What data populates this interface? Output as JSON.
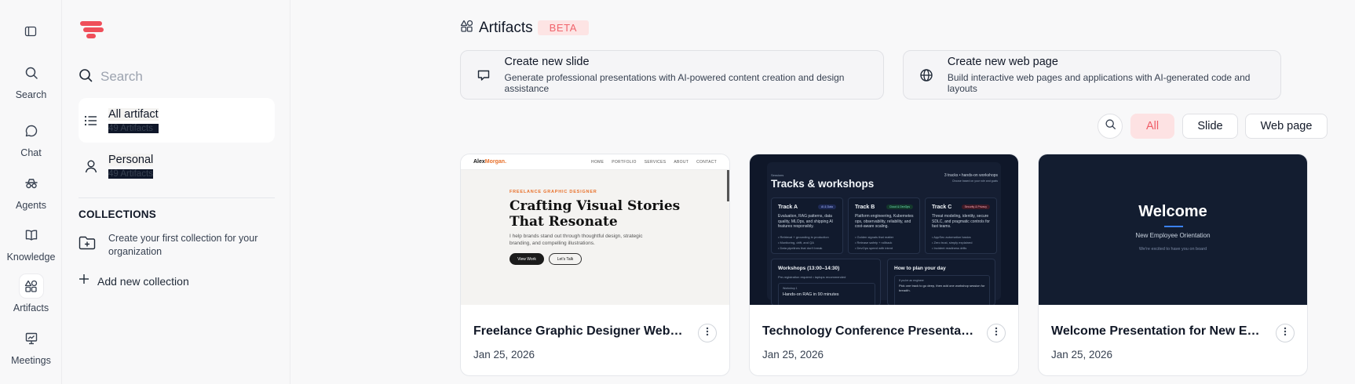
{
  "rail": {
    "items": [
      {
        "label": "Search",
        "icon": "search-icon"
      },
      {
        "label": "Chat",
        "icon": "chat-icon"
      },
      {
        "label": "Agents",
        "icon": "agents-icon"
      },
      {
        "label": "Knowledge",
        "icon": "book-icon"
      },
      {
        "label": "Artifacts",
        "icon": "artifacts-icon",
        "active": true
      },
      {
        "label": "Meetings",
        "icon": "presentation-icon"
      }
    ]
  },
  "panel": {
    "search_placeholder": "Search",
    "nav": [
      {
        "title": "All artifact",
        "count": "49 Artifacts",
        "icon": "list-icon",
        "active": true
      },
      {
        "title": "Personal",
        "count": "49 Artifacts",
        "icon": "user-icon"
      }
    ],
    "collections_heading": "COLLECTIONS",
    "collections_empty": "Create your first collection for your organization",
    "add_collection": "Add new collection"
  },
  "main": {
    "title": "Artifacts",
    "badge": "BETA",
    "create": [
      {
        "title": "Create new slide",
        "desc": "Generate professional presentations with AI-powered content creation and design assistance",
        "icon": "slide-icon"
      },
      {
        "title": "Create new web page",
        "desc": "Build interactive web pages and applications with AI-generated code and layouts",
        "icon": "globe-icon"
      }
    ],
    "filters": [
      "All",
      "Slide",
      "Web page"
    ],
    "active_filter": "All",
    "cards": [
      {
        "title": "Freelance Graphic Designer Website",
        "date": "Jan 25, 2026",
        "thumb": {
          "brand_a": "Alex",
          "brand_b": "Morgan.",
          "links": [
            "HOME",
            "PORTFOLIO",
            "SERVICES",
            "ABOUT",
            "CONTACT"
          ],
          "kicker": "FREELANCE GRAPHIC DESIGNER",
          "headline": "Crafting Visual Stories That Resonate",
          "para": "I help brands stand out through thoughtful design, strategic branding, and compelling illustrations.",
          "btn1": "View Work",
          "btn2": "Let's Talk"
        }
      },
      {
        "title": "Technology Conference Presentation",
        "date": "Jan 25, 2026",
        "thumb": {
          "kicker": "Sessions",
          "headline": "Tracks & workshops",
          "aside_1": "3 tracks • hands-on workshops",
          "aside_2": "Choose based on your role and goals",
          "tracks": [
            {
              "name": "Track A",
              "pill": "AI & Data",
              "desc": "Evaluation, RAG patterns, data quality, MLOps, and shipping AI features responsibly.",
              "bullets": [
                "• Retrieval + grounding in production",
                "• Monitoring, drift, and QA",
                "• Data pipelines that don't break"
              ]
            },
            {
              "name": "Track B",
              "pill": "Cloud & DevOps",
              "desc": "Platform engineering, Kubernetes ops, observability, reliability, and cost-aware scaling.",
              "bullets": [
                "• Golden signals that matter",
                "• Release safety + rollback",
                "• DevOps speed with intent"
              ]
            },
            {
              "name": "Track C",
              "pill": "Security & Privacy",
              "desc": "Threat modeling, identity, secure SDLC, and pragmatic controls for fast teams.",
              "bullets": [
                "• AppSec automation basics",
                "• Zero trust, simply explained",
                "• Incident readiness drills"
              ]
            }
          ],
          "workshops_title": "Workshops (13:00–14:30)",
          "workshops_sub": "Pre-registration required • laptops recommended",
          "workshop_kicker": "Workshop 1",
          "workshop_name": "Hands-on RAG in 90 minutes",
          "plan_title": "How to plan your day",
          "plan_kicker": "If you're an engineer",
          "plan_text": "Pick one track to go deep, then add one workshop session for breadth."
        }
      },
      {
        "title": "Welcome Presentation for New Employee Orientation",
        "date": "Jan 25, 2026",
        "thumb": {
          "headline": "Welcome",
          "sub": "New Employee Orientation",
          "sub2": "We're excited to have you on board"
        }
      }
    ]
  },
  "colors": {
    "accent": "#ef5d67",
    "accent_bg": "#fde2e3",
    "logo": "#ef4f5a"
  }
}
